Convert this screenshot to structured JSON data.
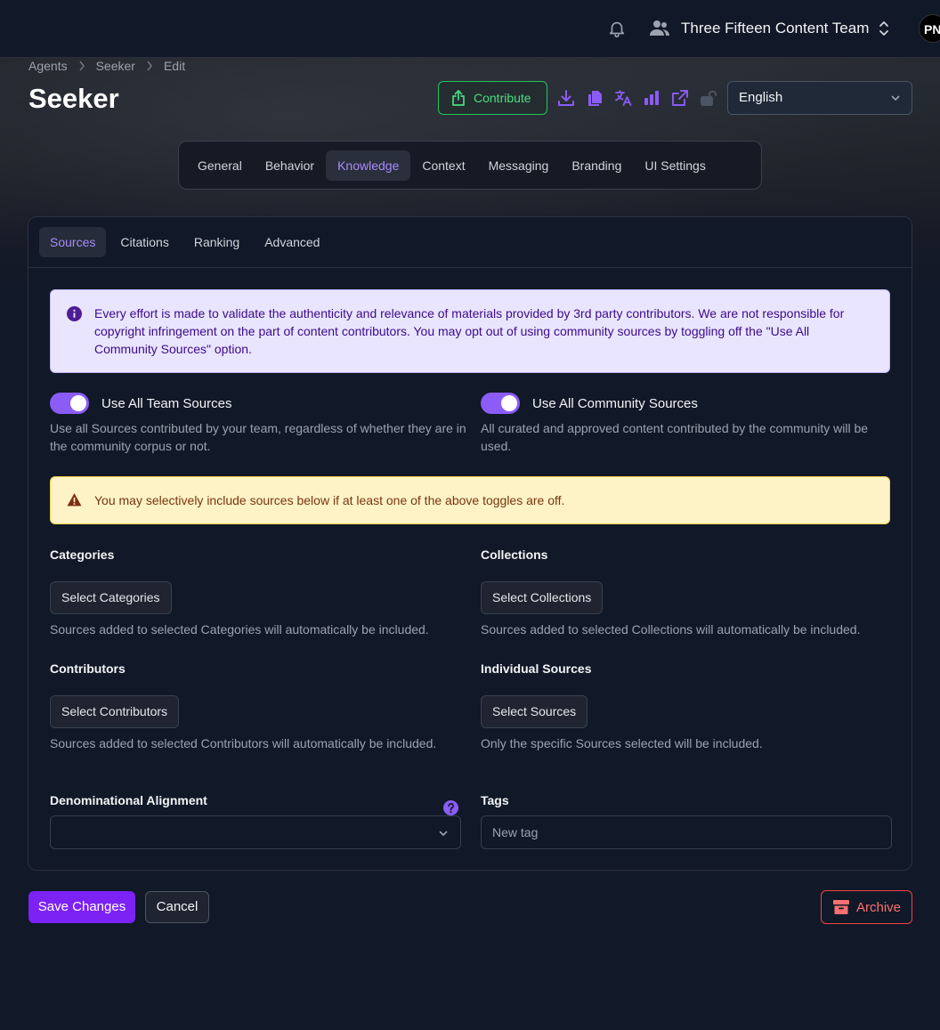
{
  "topbar": {
    "team_name": "Three Fifteen Content Team",
    "avatar_initials": "PN"
  },
  "breadcrumb": [
    "Agents",
    "Seeker",
    "Edit"
  ],
  "page_title": "Seeker",
  "toolbar": {
    "contribute_label": "Contribute",
    "icons": [
      "download-icon",
      "copy-icon",
      "translate-icon",
      "bar-chart-icon",
      "external-link-icon",
      "unlock-icon"
    ],
    "language": "English"
  },
  "main_tabs": [
    {
      "label": "General",
      "active": false
    },
    {
      "label": "Behavior",
      "active": false
    },
    {
      "label": "Knowledge",
      "active": true
    },
    {
      "label": "Context",
      "active": false
    },
    {
      "label": "Messaging",
      "active": false
    },
    {
      "label": "Branding",
      "active": false
    },
    {
      "label": "UI Settings",
      "active": false
    }
  ],
  "sub_tabs": [
    {
      "label": "Sources",
      "active": true
    },
    {
      "label": "Citations",
      "active": false
    },
    {
      "label": "Ranking",
      "active": false
    },
    {
      "label": "Advanced",
      "active": false
    }
  ],
  "info_text": "Every effort is made to validate the authenticity and relevance of materials provided by 3rd party contributors. We are not responsible for copyright infringement on the part of content contributors. You may opt out of using community sources by toggling off the \"Use All Community Sources\" option.",
  "toggles": {
    "team": {
      "label": "Use All Team Sources",
      "on": true,
      "help": "Use all Sources contributed by your team, regardless of whether they are in the community corpus or not."
    },
    "community": {
      "label": "Use All Community Sources",
      "on": true,
      "help": "All curated and approved content contributed by the community will be used."
    }
  },
  "warning_text": "You may selectively include sources below if at least one of the above toggles are off.",
  "fields": {
    "categories": {
      "label": "Categories",
      "button": "Select Categories",
      "help": "Sources added to selected Categories will automatically be included."
    },
    "collections": {
      "label": "Collections",
      "button": "Select Collections",
      "help": "Sources added to selected Collections will automatically be included."
    },
    "contributors": {
      "label": "Contributors",
      "button": "Select Contributors",
      "help": "Sources added to selected Contributors will automatically be included."
    },
    "individual": {
      "label": "Individual Sources",
      "button": "Select Sources",
      "help": "Only the specific Sources selected will be included."
    },
    "denominational": {
      "label": "Denominational Alignment",
      "value": ""
    },
    "tags": {
      "label": "Tags",
      "placeholder": "New tag"
    }
  },
  "actions": {
    "save": "Save Changes",
    "cancel": "Cancel",
    "archive": "Archive"
  },
  "colors": {
    "accent": "#8b5cf6",
    "primary_button": "#7c22f5",
    "success": "#22c55e",
    "danger": "#ef4444"
  }
}
